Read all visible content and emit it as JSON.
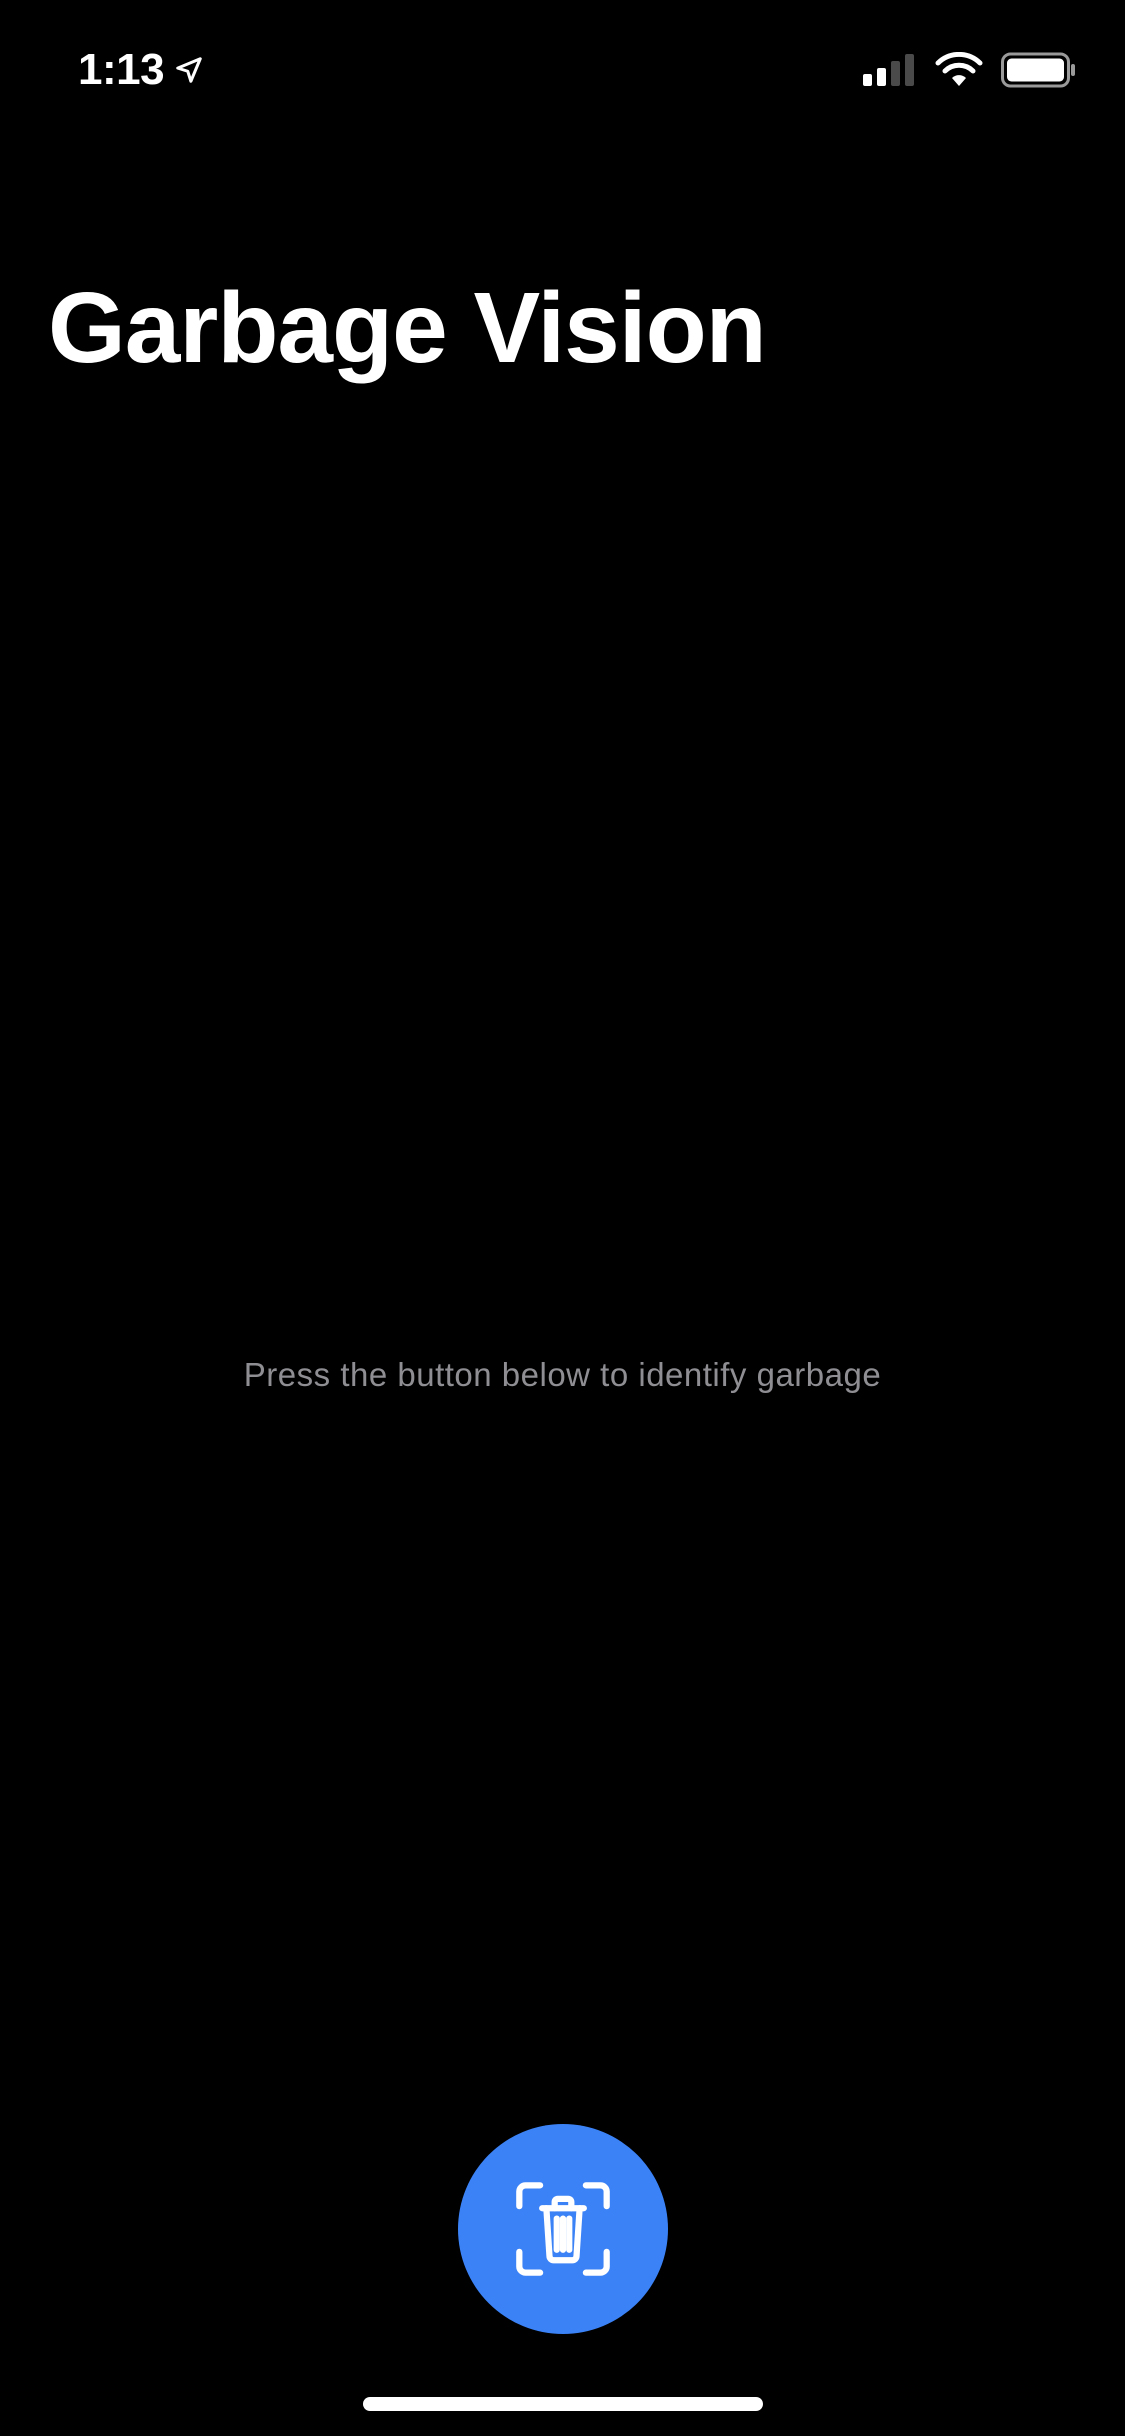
{
  "status_bar": {
    "time": "1:13",
    "location_icon": "location-arrow-icon",
    "cellular_icon": "cellular-signal-icon",
    "wifi_icon": "wifi-icon",
    "battery_icon": "battery-icon"
  },
  "header": {
    "title": "Garbage Vision"
  },
  "main": {
    "hint_text": "Press the button below to identify garbage"
  },
  "actions": {
    "scan_button_icon": "trash-scan-icon"
  },
  "colors": {
    "background": "#000000",
    "accent": "#3b82f6",
    "hint_text": "#8e8e93"
  }
}
